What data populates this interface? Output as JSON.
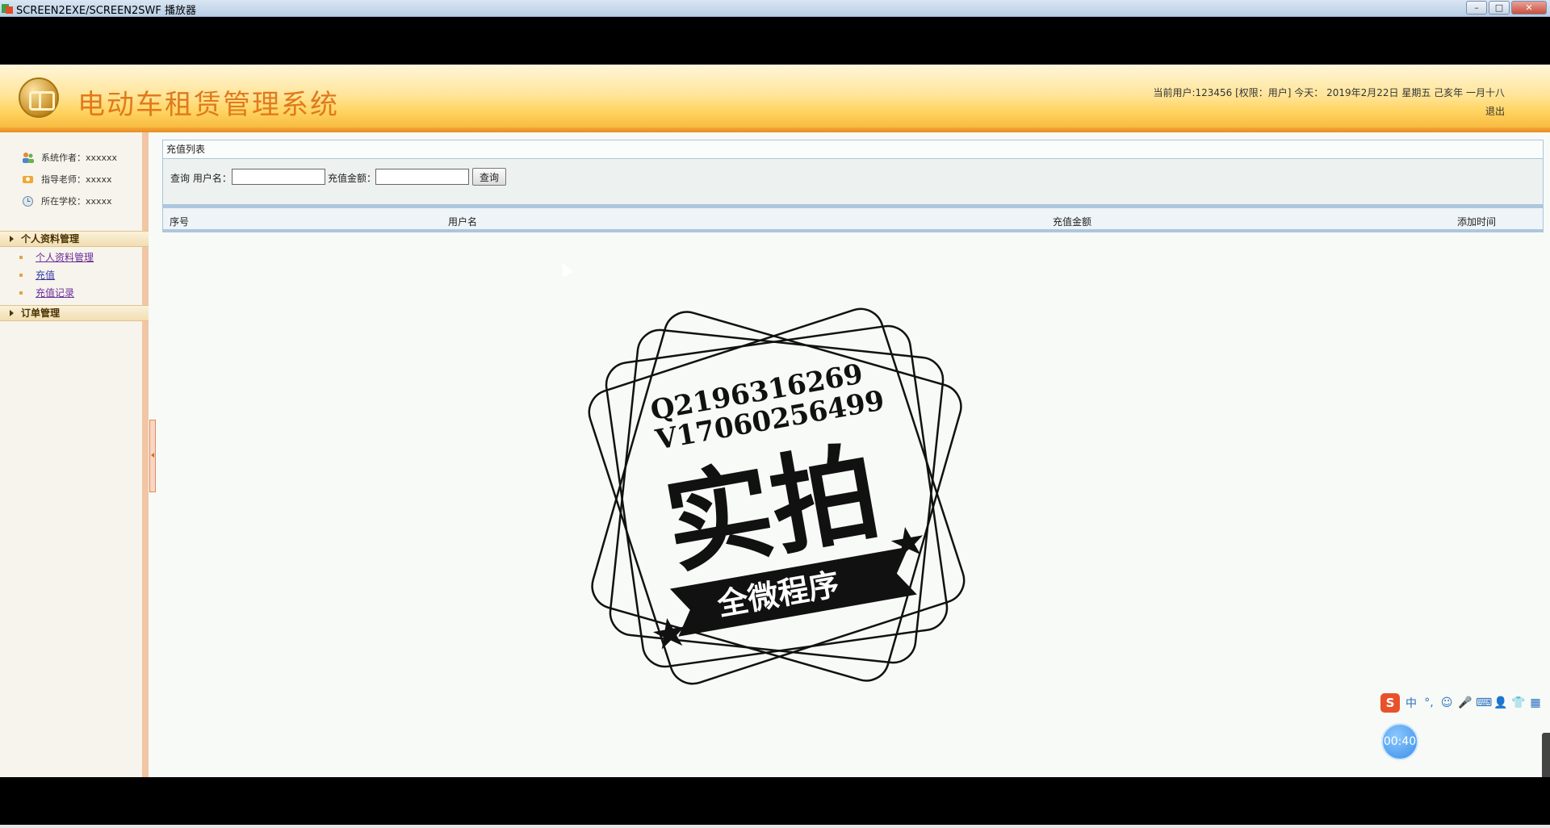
{
  "player": {
    "title": "SCREEN2EXE/SCREEN2SWF 播放器",
    "controls": [
      "–",
      "□",
      "✕"
    ]
  },
  "header": {
    "title": "电动车租赁管理系统",
    "user_info": "当前用户:123456 [权限：用户] 今天： 2019年2月22日 星期五 己亥年 一月十八",
    "logout": "退出"
  },
  "sidebar": {
    "info": [
      {
        "icon": "users-icon",
        "text": "系统作者：xxxxxx"
      },
      {
        "icon": "teacher-icon",
        "text": "指导老师：xxxxx"
      },
      {
        "icon": "school-icon",
        "text": "所在学校：xxxxx"
      }
    ],
    "menus": [
      {
        "label": "个人资料管理",
        "items": [
          "个人资料管理",
          "充值",
          "充值记录"
        ]
      },
      {
        "label": "订单管理",
        "items": []
      }
    ]
  },
  "main": {
    "panel_title": "充值列表",
    "search": {
      "prefix": "查询 用户名：",
      "amount_label": "充值金额：",
      "username_value": "",
      "amount_value": "",
      "button": "查询"
    },
    "table": {
      "columns": [
        "序号",
        "用户名",
        "充值金额",
        "添加时间"
      ],
      "rows": []
    }
  },
  "watermark": {
    "line1": "Q2196316269",
    "line2": "V17060256499",
    "big": "实拍",
    "ribbon": "全微程序"
  },
  "ime": {
    "logo": "S",
    "items": [
      "中",
      "°,",
      "☺",
      "🎤",
      "⌨",
      "👤",
      "👕",
      "▦"
    ]
  },
  "timer": "00:40",
  "colors": {
    "title_orange": "#e07a1c",
    "sidebar_border": "#f2c6a4",
    "table_border": "#a9c5de"
  }
}
